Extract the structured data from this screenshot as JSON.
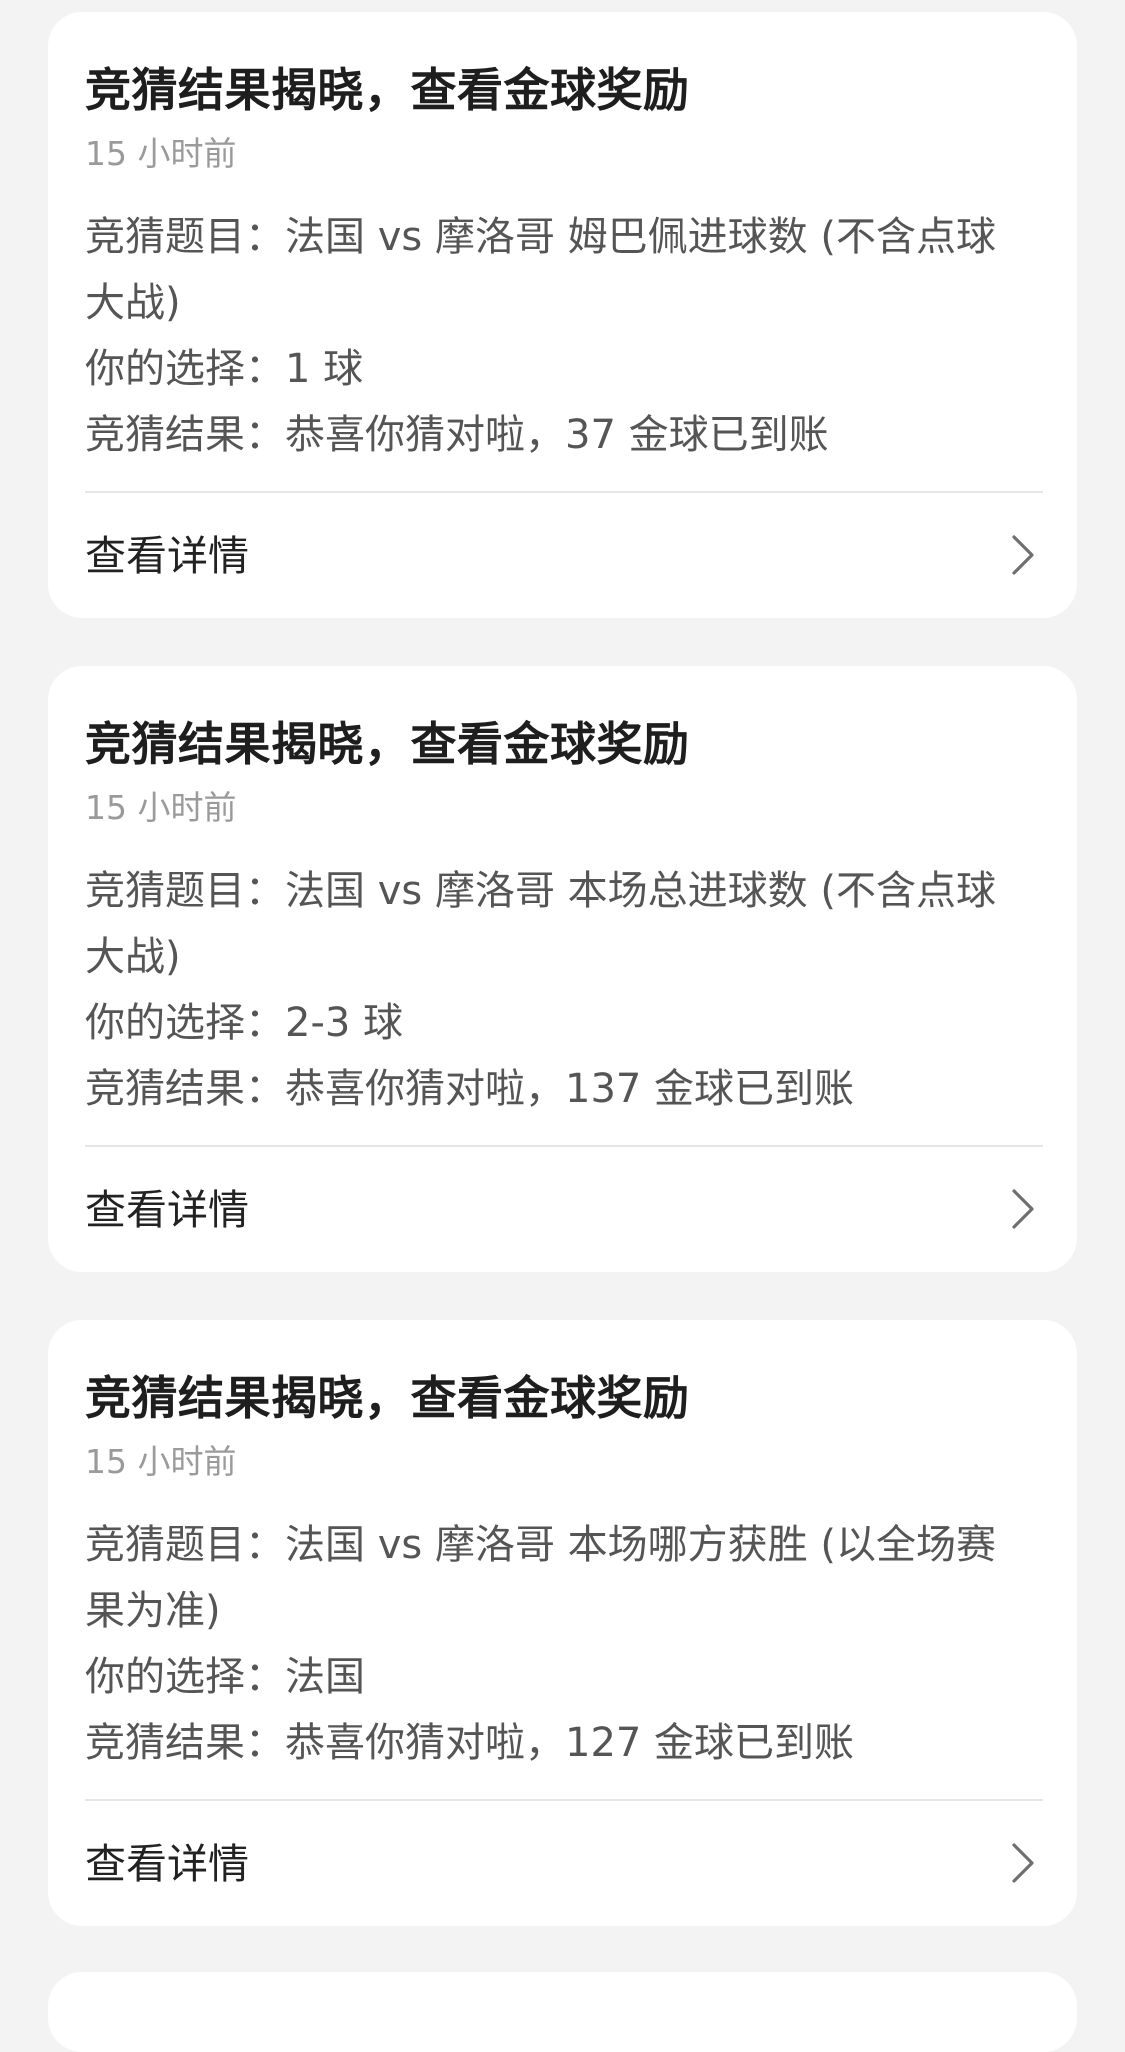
{
  "cards": [
    {
      "title": "竞猜结果揭晓，查看金球奖励",
      "time": "15 小时前",
      "question_line1": "竞猜题目：法国 vs 摩洛哥 姆巴佩进球数 (不含点球",
      "question_line2": "大战)",
      "choice": "你的选择：1 球",
      "result": "竞猜结果：恭喜你猜对啦，37 金球已到账",
      "detail_label": "查看详情"
    },
    {
      "title": "竞猜结果揭晓，查看金球奖励",
      "time": "15 小时前",
      "question_line1": "竞猜题目：法国 vs 摩洛哥 本场总进球数 (不含点球",
      "question_line2": "大战)",
      "choice": "你的选择：2-3 球",
      "result": "竞猜结果：恭喜你猜对啦，137 金球已到账",
      "detail_label": "查看详情"
    },
    {
      "title": "竞猜结果揭晓，查看金球奖励",
      "time": "15 小时前",
      "question_line1": "竞猜题目：法国 vs 摩洛哥 本场哪方获胜 (以全场赛",
      "question_line2": "果为准)",
      "choice": "你的选择：法国",
      "result": "竞猜结果：恭喜你猜对啦，127 金球已到账",
      "detail_label": "查看详情"
    }
  ],
  "icons": {
    "detail_arrow": "chevron-right-icon"
  },
  "colors": {
    "background": "#f3f3f3",
    "card": "#ffffff",
    "title": "#1e1e1e",
    "muted": "#9a9a9a",
    "body": "#555555"
  }
}
